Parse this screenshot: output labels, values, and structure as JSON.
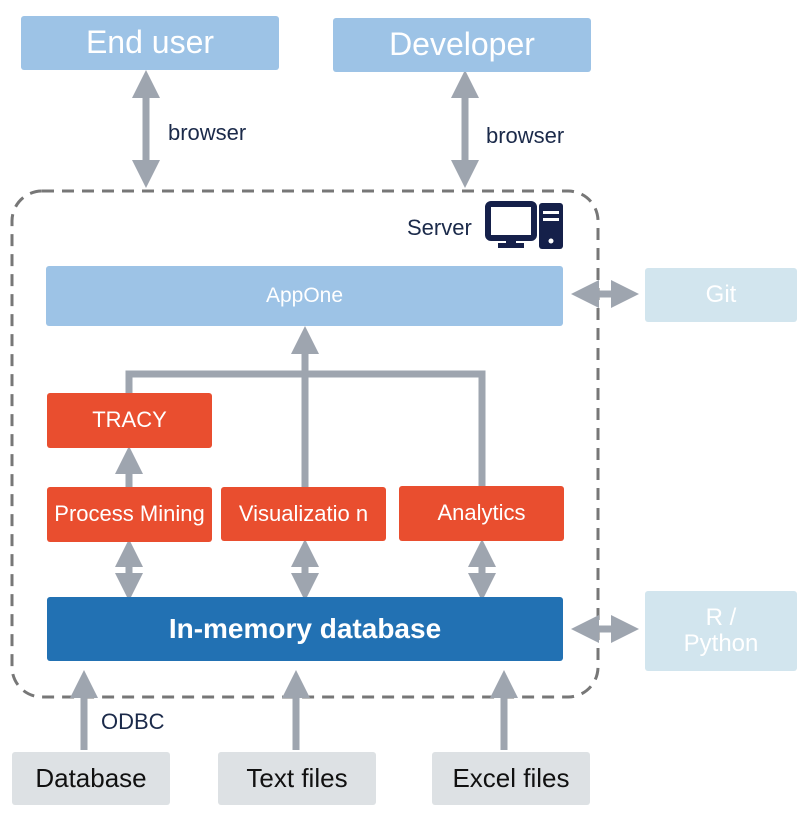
{
  "actors": {
    "end_user": "End user",
    "developer": "Developer"
  },
  "labels": {
    "browser_left": "browser",
    "browser_right": "browser",
    "server": "Server",
    "odbc": "ODBC"
  },
  "server": {
    "appone": "AppOne",
    "tracy": "TRACY",
    "process_mining": "Process Mining",
    "visualization": "Visualizatio n",
    "analytics": "Analytics",
    "database": "In-memory database"
  },
  "external": {
    "git": "Git",
    "r_python": "R / Python"
  },
  "sources": {
    "database": "Database",
    "text_files": "Text files",
    "excel_files": "Excel files"
  },
  "colors": {
    "actor": "#9DC3E6",
    "module": "#E94E2F",
    "database": "#2271B3",
    "external": "#D2E5EE",
    "source": "#DDE1E4",
    "arrow": "#9EA5AF",
    "server_icon": "#15204A"
  },
  "icons": {
    "server": "desktop-tower-icon"
  }
}
